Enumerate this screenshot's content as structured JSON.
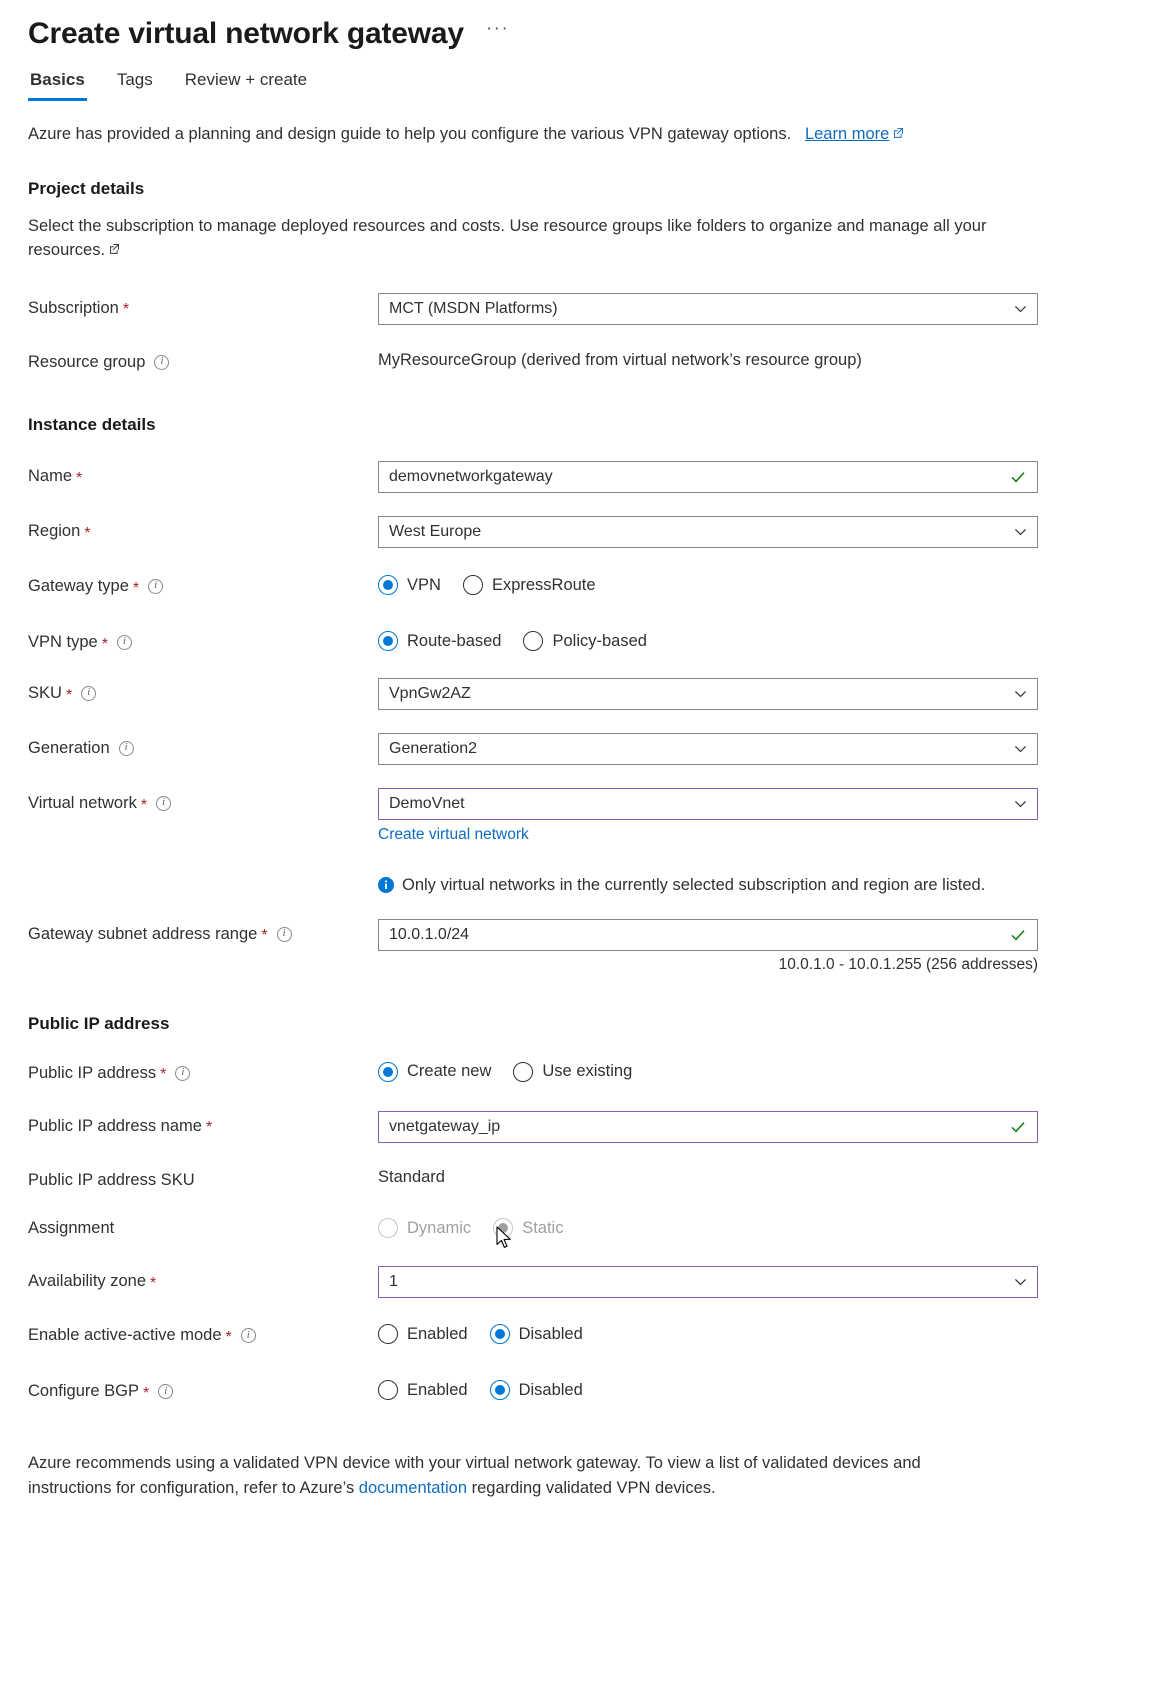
{
  "header": {
    "title": "Create virtual network gateway",
    "more_label": "···"
  },
  "tabs": [
    {
      "label": "Basics",
      "active": true
    },
    {
      "label": "Tags",
      "active": false
    },
    {
      "label": "Review + create",
      "active": false
    }
  ],
  "intro": {
    "text": "Azure has provided a planning and design guide to help you configure the various VPN gateway options.",
    "link_label": "Learn more"
  },
  "project_details": {
    "heading": "Project details",
    "description": "Select the subscription to manage deployed resources and costs. Use resource groups like folders to organize and manage all your resources.",
    "subscription_label": "Subscription",
    "subscription_value": "MCT (MSDN Platforms)",
    "resource_group_label": "Resource group",
    "resource_group_value": "MyResourceGroup (derived from virtual network’s resource group)"
  },
  "instance_details": {
    "heading": "Instance details",
    "name_label": "Name",
    "name_value": "demovnetworkgateway",
    "region_label": "Region",
    "region_value": "West Europe",
    "gateway_type_label": "Gateway type",
    "gateway_type_options": [
      "VPN",
      "ExpressRoute"
    ],
    "gateway_type_selected": "VPN",
    "vpn_type_label": "VPN type",
    "vpn_type_options": [
      "Route-based",
      "Policy-based"
    ],
    "vpn_type_selected": "Route-based",
    "sku_label": "SKU",
    "sku_value": "VpnGw2AZ",
    "generation_label": "Generation",
    "generation_value": "Generation2",
    "virtual_network_label": "Virtual network",
    "virtual_network_value": "DemoVnet",
    "create_vnet_link": "Create virtual network",
    "vnet_info_message": "Only virtual networks in the currently selected subscription and region are listed.",
    "subnet_label": "Gateway subnet address range",
    "subnet_value": "10.0.1.0/24",
    "subnet_hint": "10.0.1.0 - 10.0.1.255 (256 addresses)"
  },
  "public_ip": {
    "heading": "Public IP address",
    "public_ip_label": "Public IP address",
    "public_ip_options": [
      "Create new",
      "Use existing"
    ],
    "public_ip_selected": "Create new",
    "name_label": "Public IP address name",
    "name_value": "vnetgateway_ip",
    "sku_label": "Public IP address SKU",
    "sku_value": "Standard",
    "assignment_label": "Assignment",
    "assignment_options": [
      "Dynamic",
      "Static"
    ],
    "assignment_selected": "Static",
    "availability_zone_label": "Availability zone",
    "availability_zone_value": "1",
    "active_active_label": "Enable active-active mode",
    "active_active_options": [
      "Enabled",
      "Disabled"
    ],
    "active_active_selected": "Disabled",
    "bgp_label": "Configure BGP",
    "bgp_options": [
      "Enabled",
      "Disabled"
    ],
    "bgp_selected": "Disabled"
  },
  "footer": {
    "text_before": "Azure recommends using a validated VPN device with your virtual network gateway. To view a list of validated devices and instructions for configuration, refer to Azure’s ",
    "link_label": "documentation",
    "text_after": " regarding validated VPN devices."
  },
  "colors": {
    "accent": "#0078d4",
    "link": "#0f6cbd",
    "required": "#a4262c",
    "touched_border": "#8764b8",
    "success": "#107c10"
  }
}
